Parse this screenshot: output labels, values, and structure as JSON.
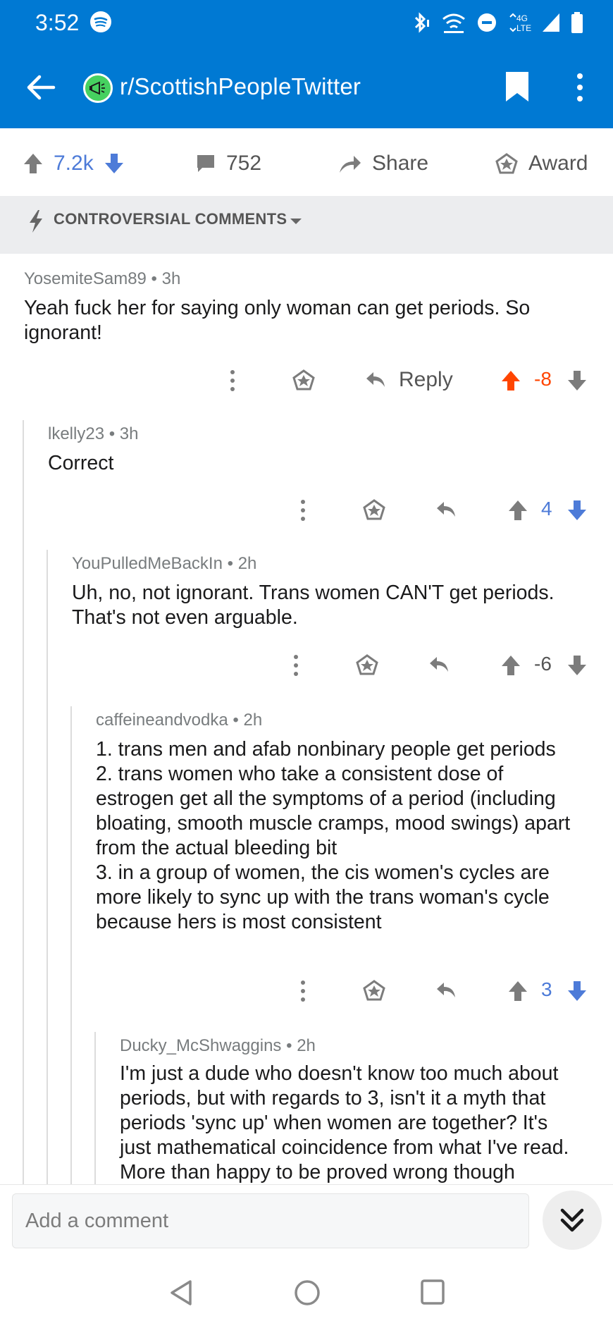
{
  "status": {
    "time": "3:52",
    "network_label": "4G\nLTE",
    "icons": [
      "spotify-icon",
      "bluetooth-icon",
      "wifi-icon",
      "dnd-icon",
      "signal-icon",
      "battery-icon"
    ]
  },
  "header": {
    "subreddit": "r/ScottishPeopleTwitter"
  },
  "post_actions": {
    "upvotes": "7.2k",
    "comments": "752",
    "share": "Share",
    "award": "Award"
  },
  "sort": {
    "label": "CONTROVERSIAL COMMENTS"
  },
  "comments": [
    {
      "author": "YosemiteSam89",
      "age": "3h",
      "lines": [
        "Yeah fuck her for saying only woman can get periods. So",
        "ignorant!"
      ],
      "reply_label": "Reply",
      "score": "-8"
    },
    {
      "author": "lkelly23",
      "age": "3h",
      "lines": [
        "Correct"
      ],
      "score": "4"
    },
    {
      "author": "YouPulledMeBackIn",
      "age": "2h",
      "lines": [
        "Uh, no, not ignorant. Trans women CAN'T get periods.",
        "That's not even arguable."
      ],
      "score": "-6"
    },
    {
      "author": "caffeineandvodka",
      "age": "2h",
      "lines": [
        "1. trans men and afab nonbinary people get periods",
        "2. trans women who take a consistent dose of",
        "estrogen get all the symptoms of a period (including",
        "bloating, smooth muscle cramps, mood swings) apart",
        "from the actual bleeding bit",
        "3. in a group of women, the cis women's cycles are",
        "more likely to sync up with the trans woman's cycle",
        "because hers is most consistent"
      ],
      "score": "3"
    },
    {
      "author": "Ducky_McShwaggins",
      "age": "2h",
      "lines": [
        "I'm just a dude who doesn't know too much about",
        "periods, but with regards to 3, isn't it a myth that",
        "periods 'sync up' when women are together? It's",
        "just mathematical coincidence from what I've read.",
        "More than happy to be proved wrong though"
      ]
    }
  ],
  "compose": {
    "placeholder": "Add a comment"
  },
  "colors": {
    "brand_blue": "#0079d3",
    "upvote_orange": "#ff4500",
    "vote_blue": "#4d7bd8",
    "meta_gray": "#787c7e"
  }
}
